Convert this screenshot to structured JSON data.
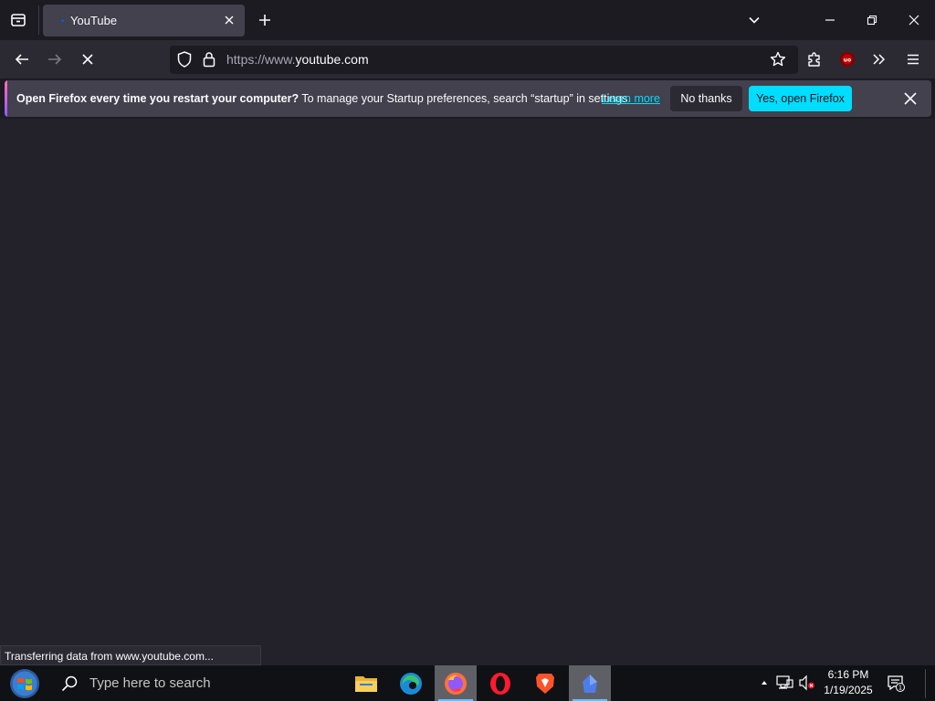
{
  "tab": {
    "title": "YouTube"
  },
  "urlbar": {
    "prefix": "https://www.",
    "domain": "youtube.com"
  },
  "notification": {
    "bold": "Open Firefox every time you restart your computer?",
    "text": " To manage your Startup preferences, search “startup” in settings.",
    "learn_more": "Learn more",
    "no_thanks": "No thanks",
    "yes_open": "Yes, open Firefox"
  },
  "status": "Transferring data from www.youtube.com...",
  "taskbar": {
    "search_placeholder": "Type here to search",
    "apps": [
      "file-explorer",
      "edge",
      "firefox",
      "opera",
      "brave",
      "app"
    ],
    "time": "6:16 PM",
    "date": "1/19/2025",
    "notif_count": "1"
  },
  "colors": {
    "accent": "#00ddff",
    "tab_bg": "#42414d",
    "content_bg": "#23222b"
  }
}
